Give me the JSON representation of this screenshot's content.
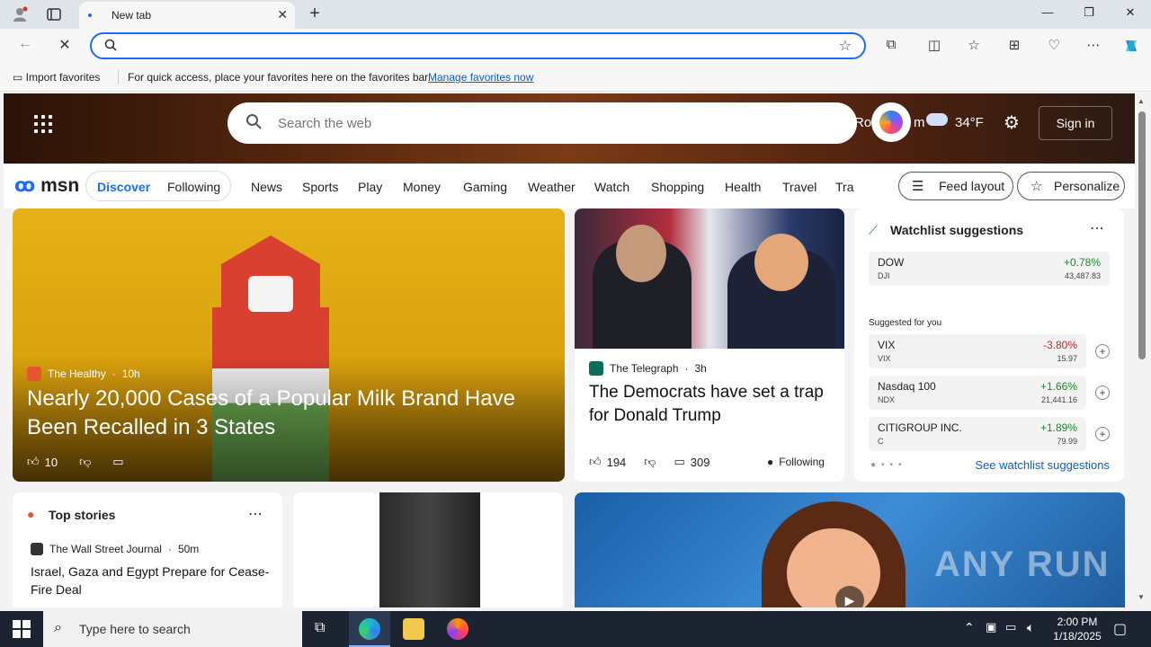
{
  "browser": {
    "tab_title": "New tab",
    "address_value": "",
    "favbar": {
      "import_label": "Import favorites",
      "message": "For quick access, place your favorites here on the favorites bar.",
      "manage_link": "Manage favorites now"
    },
    "accent": "#1b6ef3"
  },
  "msn": {
    "search_placeholder": "Search the web",
    "hero_location": "Ro",
    "hero_location_tail": "m",
    "temperature": "34°F",
    "signin": "Sign in",
    "logo_text": "msn",
    "tabs": {
      "discover": "Discover",
      "following": "Following"
    },
    "nav": [
      "News",
      "Sports",
      "Play",
      "Money",
      "Gaming",
      "Weather",
      "Watch",
      "Shopping",
      "Health",
      "Travel",
      "Tra"
    ],
    "feed_layout": "Feed layout",
    "personalize": "Personalize"
  },
  "hero_story": {
    "source": "The Healthy",
    "age": "10h",
    "title": "Nearly 20,000 Cases of a Popular Milk Brand Have Been Recalled in 3 States",
    "likes": "10"
  },
  "second_story": {
    "source": "The Telegraph",
    "age": "3h",
    "title": "The Democrats have set a trap for Donald Trump",
    "likes": "194",
    "comments": "309",
    "following": "Following"
  },
  "watchlist": {
    "title": "Watchlist suggestions",
    "suggested_label": "Suggested for you",
    "see_link": "See watchlist suggestions",
    "main": {
      "name": "DOW",
      "symbol": "DJI",
      "change": "+0.78%",
      "price": "43,487.83"
    },
    "items": [
      {
        "name": "VIX",
        "symbol": "VIX",
        "change": "-3.80%",
        "price": "15.97",
        "dir": "down"
      },
      {
        "name": "Nasdaq 100",
        "symbol": "NDX",
        "change": "+1.66%",
        "price": "21,441.16",
        "dir": "up"
      },
      {
        "name": "CITIGROUP INC.",
        "symbol": "C",
        "change": "+1.89%",
        "price": "79.99",
        "dir": "up"
      }
    ]
  },
  "top_stories": {
    "title": "Top stories",
    "source": "The Wall Street Journal",
    "age": "50m",
    "headline": "Israel, Gaza and Egypt Prepare for Cease-Fire Deal"
  },
  "taskbar": {
    "search_placeholder": "Type here to search",
    "time": "2:00 PM",
    "date": "1/18/2025"
  },
  "watermark": "ANY RUN"
}
